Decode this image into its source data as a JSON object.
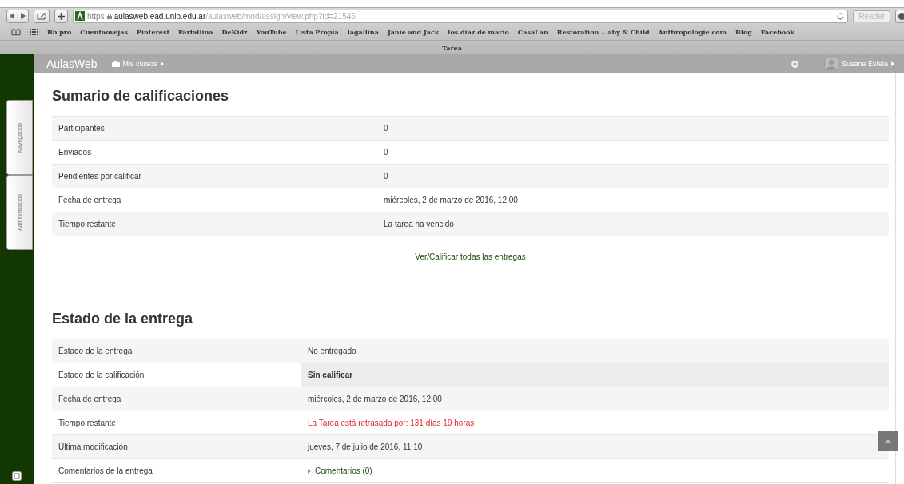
{
  "browser": {
    "url": {
      "scheme": "https",
      "host": "aulasweb.ead.unlp.edu.ar",
      "path": "/aulasweb/mod/assign/view.php?id=21546"
    },
    "reader_button": "Reader",
    "bookmarks": [
      "Bb pro",
      "Cuentaovejas",
      "Pinterest",
      "Farfallina",
      "DeKidz",
      "YouTube",
      "Lista Propia",
      "lagallina",
      "Janie and Jack",
      "los diaz de mario",
      "CasaLan",
      "Restoration ...aby & Child",
      "Anthropologie.com",
      "Blog",
      "Facebook"
    ],
    "tab_title": "Tarea"
  },
  "navbar": {
    "brand": "AulasWeb",
    "menu": "Mis cursos",
    "user": "Susana Estela"
  },
  "sidebar": {
    "tabs": [
      "Navegación",
      "Administración"
    ]
  },
  "grading_summary": {
    "title": "Sumario de calificaciones",
    "rows": [
      {
        "label": "Participantes",
        "value": "0"
      },
      {
        "label": "Enviados",
        "value": "0"
      },
      {
        "label": "Pendientes por calificar",
        "value": "0"
      },
      {
        "label": "Fecha de entrega",
        "value": "miércoles, 2 de marzo de 2016, 12:00"
      },
      {
        "label": "Tiempo restante",
        "value": "La tarea ha vencido"
      }
    ],
    "link": "Ver/Calificar todas las entregas"
  },
  "submission_status": {
    "title": "Estado de la entrega",
    "rows": [
      {
        "label": "Estado de la entrega",
        "value": "No entregado",
        "kind": "text"
      },
      {
        "label": "Estado de la calificación",
        "value": "Sin calificar",
        "kind": "emphasis"
      },
      {
        "label": "Fecha de entrega",
        "value": "miércoles, 2 de marzo de 2016, 12:00",
        "kind": "text"
      },
      {
        "label": "Tiempo restante",
        "value": "La Tarea está retrasada por: 131 días 19 horas",
        "kind": "alert"
      },
      {
        "label": "Última modificación",
        "value": "jueves, 7 de julio de 2016, 11:10",
        "kind": "text"
      },
      {
        "label": "Comentarios de la entrega",
        "value": "Comentarios (0)",
        "kind": "toggle"
      }
    ]
  }
}
